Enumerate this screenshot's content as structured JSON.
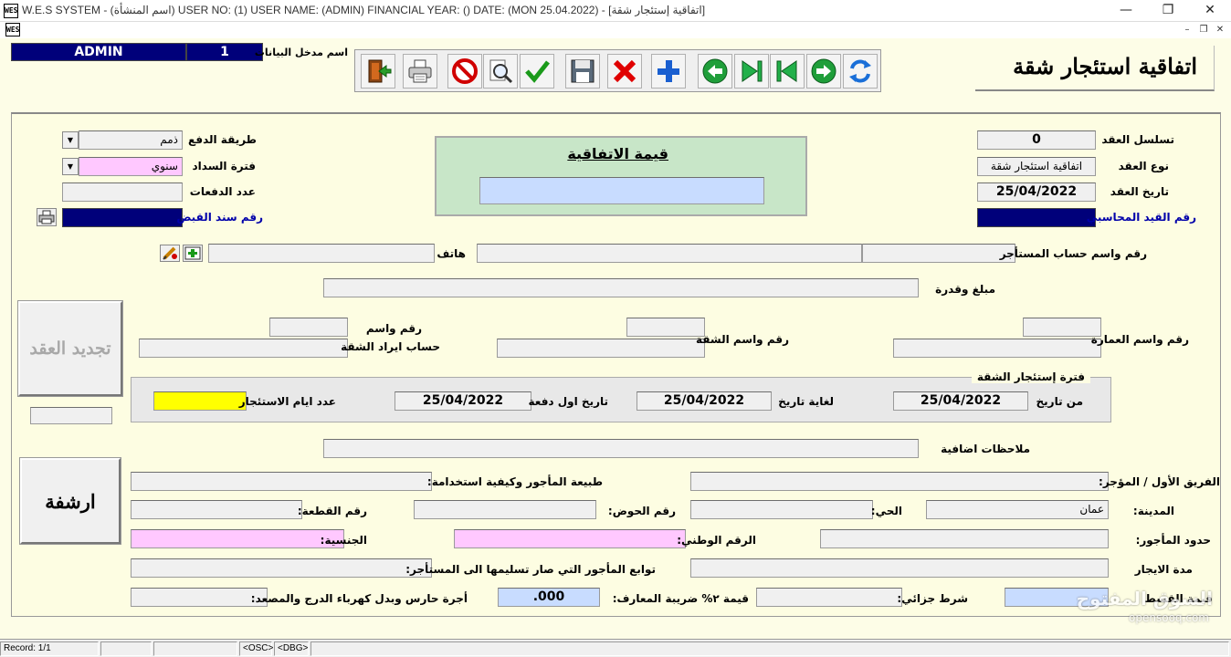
{
  "window": {
    "title": "W.E.S SYSTEM -  (اسم المنشأة)  USER NO: (1) USER NAME: (ADMIN) FINANCIAL YEAR: ()  DATE: (MON 25.04.2022) - [اتفاقية إستئجار شقة]",
    "icon_text": "WES",
    "minimize": "—",
    "restore": "❐",
    "close": "✕",
    "mdi_min": "–",
    "mdi_restore": "❐",
    "mdi_close": "✕"
  },
  "header": {
    "user_name": "ADMIN",
    "user_no": "1",
    "user_label": "اسم مدخل البيانات",
    "form_title": "اتفاقية استئجار شقة"
  },
  "toolbar": {
    "exit": "exit-icon",
    "print": "printer-icon",
    "cancel": "stop-icon",
    "preview": "magnifier-icon",
    "confirm": "checkmark-icon",
    "save": "floppy-icon",
    "delete": "x-icon",
    "add": "plus-icon",
    "prev": "arrow-left-icon",
    "last": "skip-end-icon",
    "first": "skip-start-icon",
    "next": "arrow-right-icon",
    "refresh": "refresh-icon"
  },
  "contract": {
    "serial_label": "تسلسل العقد",
    "serial": "0",
    "type_label": "نوع العقد",
    "type": "اتفاقية استئجار شقة",
    "date_label": "تاريخ العقد",
    "date": "25/04/2022",
    "journal_label": "رقم القيد المحاسبي",
    "value_title": "قيمة الاتفاقية",
    "payment_method_label": "طريقة الدفع",
    "payment_method": "ذمم",
    "payment_period_label": "فترة السداد",
    "payment_period": "سنوي",
    "payments_count_label": "عدد الدفعات",
    "receipt_label": "رقم سند القبض"
  },
  "tenant": {
    "account_label": "رقم واسم حساب المستأجر",
    "phone_label": "هاتف",
    "deposit_label": "مبلغ وقدرة"
  },
  "property": {
    "building_label": "رقم واسم العمارة",
    "apartment_label": "رقم واسم الشقة",
    "revenue_label_1": "رقم واسم",
    "revenue_label_2": "حساب ايراد الشقة",
    "renew_button": "تجديد العقد",
    "archive_button": "ارشفة"
  },
  "period": {
    "title": "فترة إستئجار الشقة",
    "from_label": "من تاريخ",
    "from": "25/04/2022",
    "to_label": "لغاية تاريخ",
    "to": "25/04/2022",
    "first_payment_label": "تاريخ اول دفعة",
    "first_payment": "25/04/2022",
    "days_label": "عدد ايام الاستئجار"
  },
  "notes_label": "ملاحظات اضافية",
  "parties": {
    "first_party_label": "الفريق الأول / المؤجر:",
    "usage_label": "طبيعة المأجور وكيفية استخدامة:",
    "city_label": "المدينة:",
    "city": "عمان",
    "district_label": "الحي:",
    "basin_label": "رقم الحوض:",
    "plot_label": "رقم القطعة:",
    "borders_label": "حدود المأجور:",
    "national_id_label": "الرقم الوطني:",
    "nationality_label": "الجنسية:",
    "lease_period_label": "مدة الايجار",
    "accessories_label": "توابع المأجور التي صار تسليمها الى المستأجر:",
    "installment_label": "قيمة القسط",
    "penalty_label": "شرط جزائي:",
    "tax_label": "قيمة ٢% ضريبة المعارف:",
    "tax_value": ".000",
    "guard_fee_label": "أجرة حارس وبدل كهرباء الدرج والمصعد:"
  },
  "status": {
    "record": "Record: 1/1",
    "osc": "<OSC>",
    "dbg": "<DBG>"
  },
  "watermark": {
    "arabic": "السوق المفتوح",
    "latin": "opensooq.com"
  },
  "colors": {
    "background": "#fdfde7",
    "navy": "#00007a",
    "pink": "#ffc8ff",
    "light_blue": "#c8dcff",
    "green_box": "#c8e6c8",
    "yellow": "#ffff00"
  }
}
